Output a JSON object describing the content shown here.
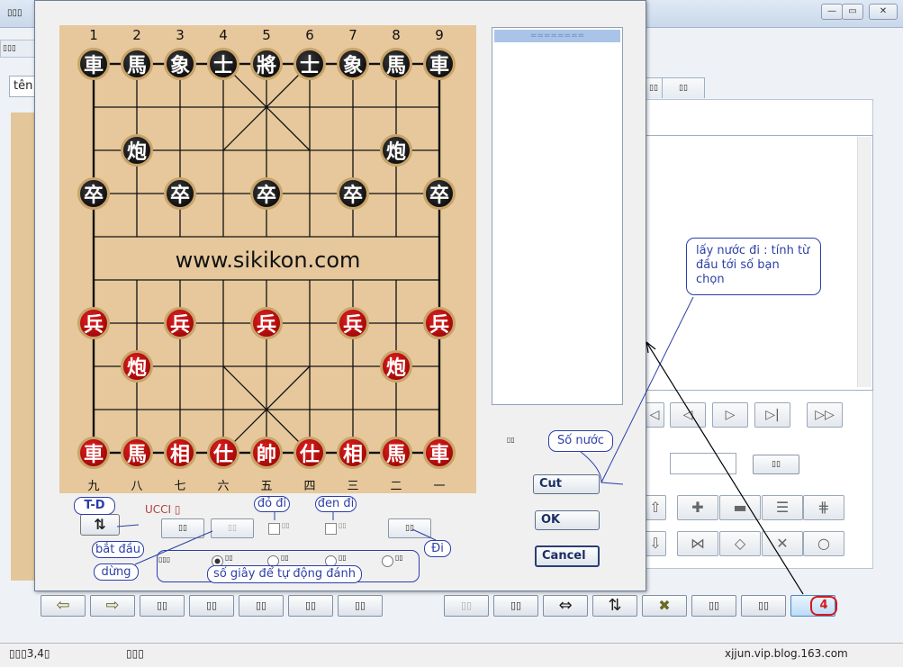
{
  "main_window": {
    "title": "▯▯▯",
    "menu_label": "▯▯▯",
    "name_field": "tên",
    "tabs": [
      "▯▯",
      "▯▯"
    ],
    "caption_buttons": [
      "—",
      "▭",
      "✕"
    ],
    "status": {
      "left": "▯▯▯3,4▯",
      "middle": "▯▯▯",
      "right": "xjjun.vip.blog.163.com"
    },
    "toolbar_left_arrows": [
      "⇦",
      "⇨"
    ],
    "toolbar_left_buttons": [
      "▯▯",
      "▯▯",
      "▯▯",
      "▯▯",
      "▯▯"
    ],
    "toolbar_right_buttons": [
      "▯▯",
      "▯▯",
      "⇔",
      "⇅",
      "✖",
      "▯▯",
      "▯▯"
    ],
    "badge_4": "4",
    "nav_buttons": [
      "◁",
      "◁",
      "▷",
      "▷|",
      "▷▷"
    ],
    "side_button": "▯▯",
    "shape_row1": [
      "⇧",
      "✚",
      "▬",
      "☰",
      "⋕"
    ],
    "shape_row2": [
      "⇩",
      "⋈",
      "◇",
      "✕",
      "○"
    ]
  },
  "dialog": {
    "watermark": "www.sikikon.com",
    "top_numbers": [
      "1",
      "2",
      "3",
      "4",
      "5",
      "6",
      "7",
      "8",
      "9"
    ],
    "bottom_numbers": [
      "九",
      "八",
      "七",
      "六",
      "五",
      "四",
      "三",
      "二",
      "一"
    ],
    "black_pieces": {
      "back": [
        "車",
        "馬",
        "象",
        "士",
        "將",
        "士",
        "象",
        "馬",
        "車"
      ],
      "cannon": "炮",
      "soldier": "卒"
    },
    "red_pieces": {
      "back": [
        "車",
        "馬",
        "相",
        "仕",
        "帥",
        "仕",
        "相",
        "馬",
        "車"
      ],
      "cannon": "炮",
      "soldier": "兵"
    },
    "move_list_selected": "========",
    "ucci_label": "UCCI ▯",
    "td_label": "T-D",
    "arrow_icon": "⇅",
    "start_btn": "▯▯",
    "stop_btn": "▯▯",
    "red_go_check": "▯▯",
    "black_go_check": "▯▯",
    "go_btn": "▯▯",
    "timer_label": "▯▯▯",
    "radio_labels": [
      "▯▯",
      "▯▯",
      "▯▯",
      "▯▯"
    ],
    "small_label": "▯▯",
    "cut_btn": "Cut",
    "ok_btn": "OK",
    "cancel_btn": "Cancel"
  },
  "annotations": {
    "callout_main": "lấy nước đi  : tính từ đầu tới số bạn chọn",
    "so_nuoc": "Số nước",
    "do_di": "đỏ đi",
    "den_di": "đen đi",
    "bat_dau": "bắt đầu",
    "dung": "dừng",
    "di": "Đi",
    "so_giay": "số giây để tự động đánh",
    "td": "T-D"
  }
}
